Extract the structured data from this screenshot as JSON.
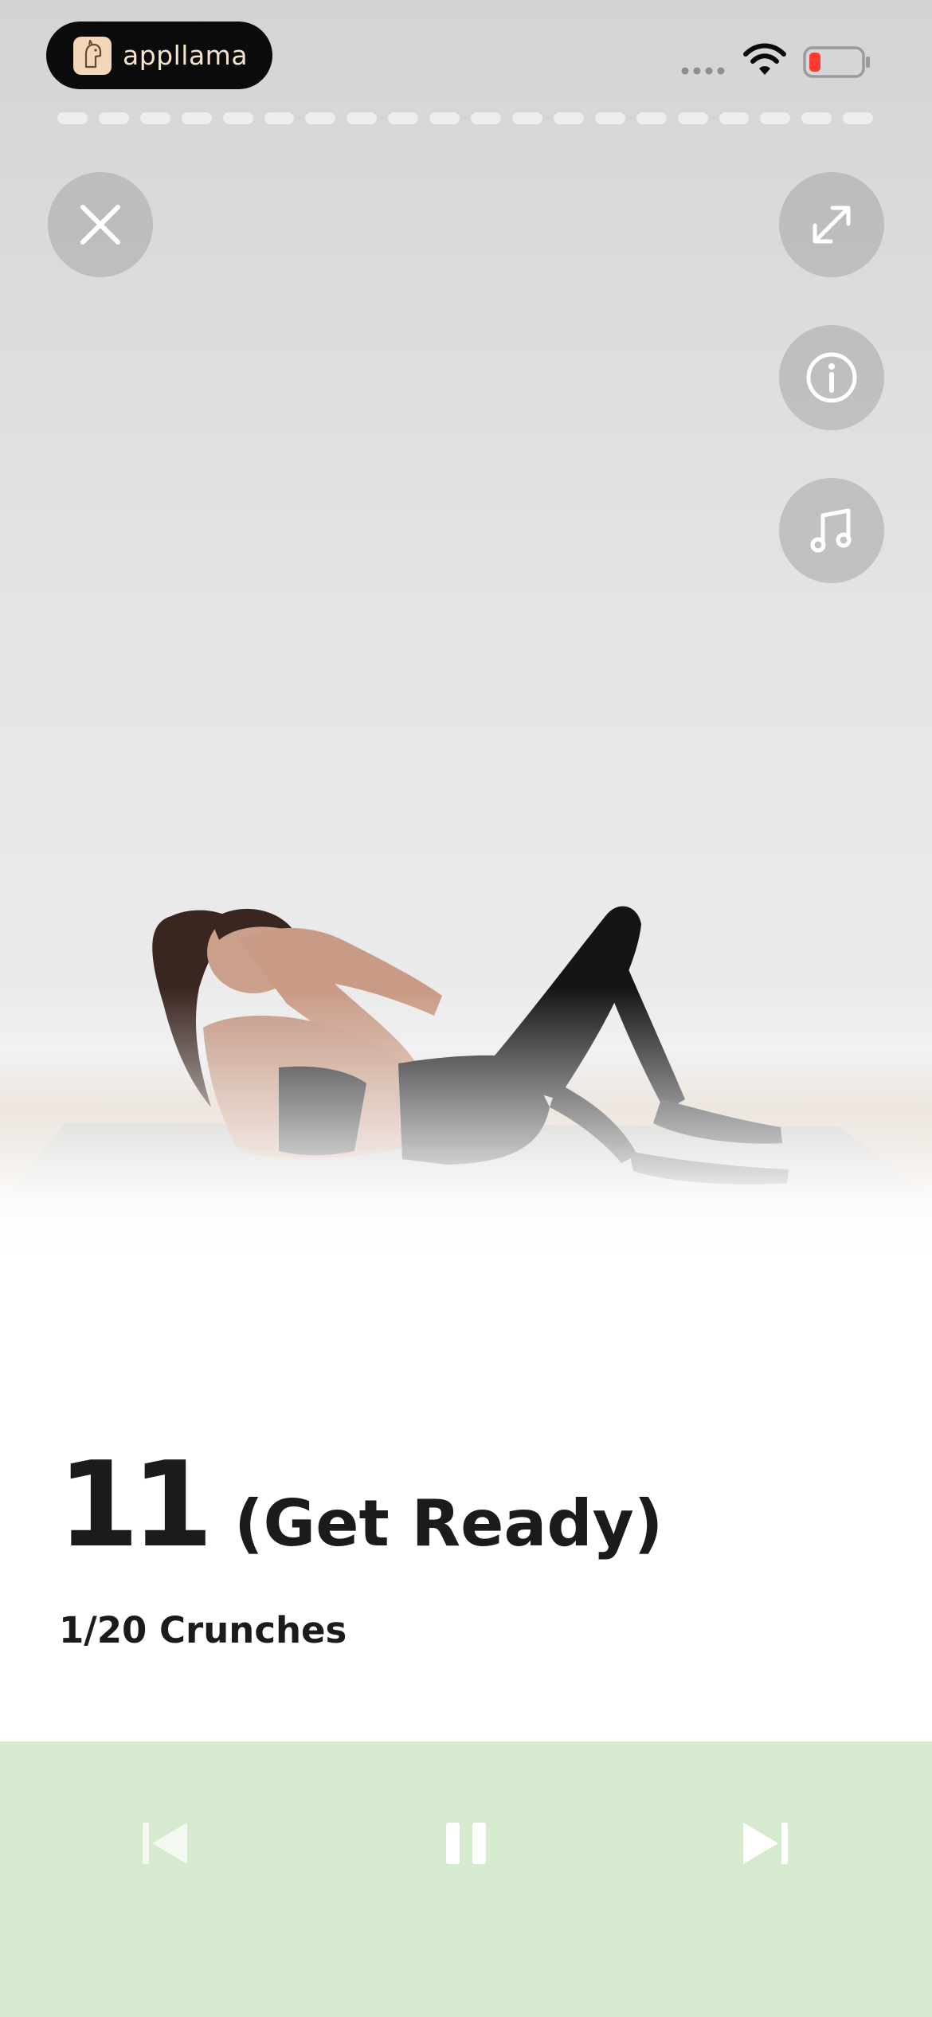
{
  "status_bar": {
    "app_name": "appllama",
    "battery_color": "#ff3b30"
  },
  "progress": {
    "segment_count": 20,
    "current_index": 1
  },
  "video": {
    "buttons": [
      "close-icon",
      "expand-icon",
      "info-icon",
      "music-note-icon"
    ]
  },
  "workout": {
    "countdown": "11",
    "phase": "(Get Ready)",
    "exercise": "1/20 Crunches"
  },
  "controls": {
    "background": "#d5eacf",
    "icons": [
      "skip-previous-icon",
      "pause-icon",
      "skip-next-icon"
    ],
    "previous_enabled": false
  }
}
